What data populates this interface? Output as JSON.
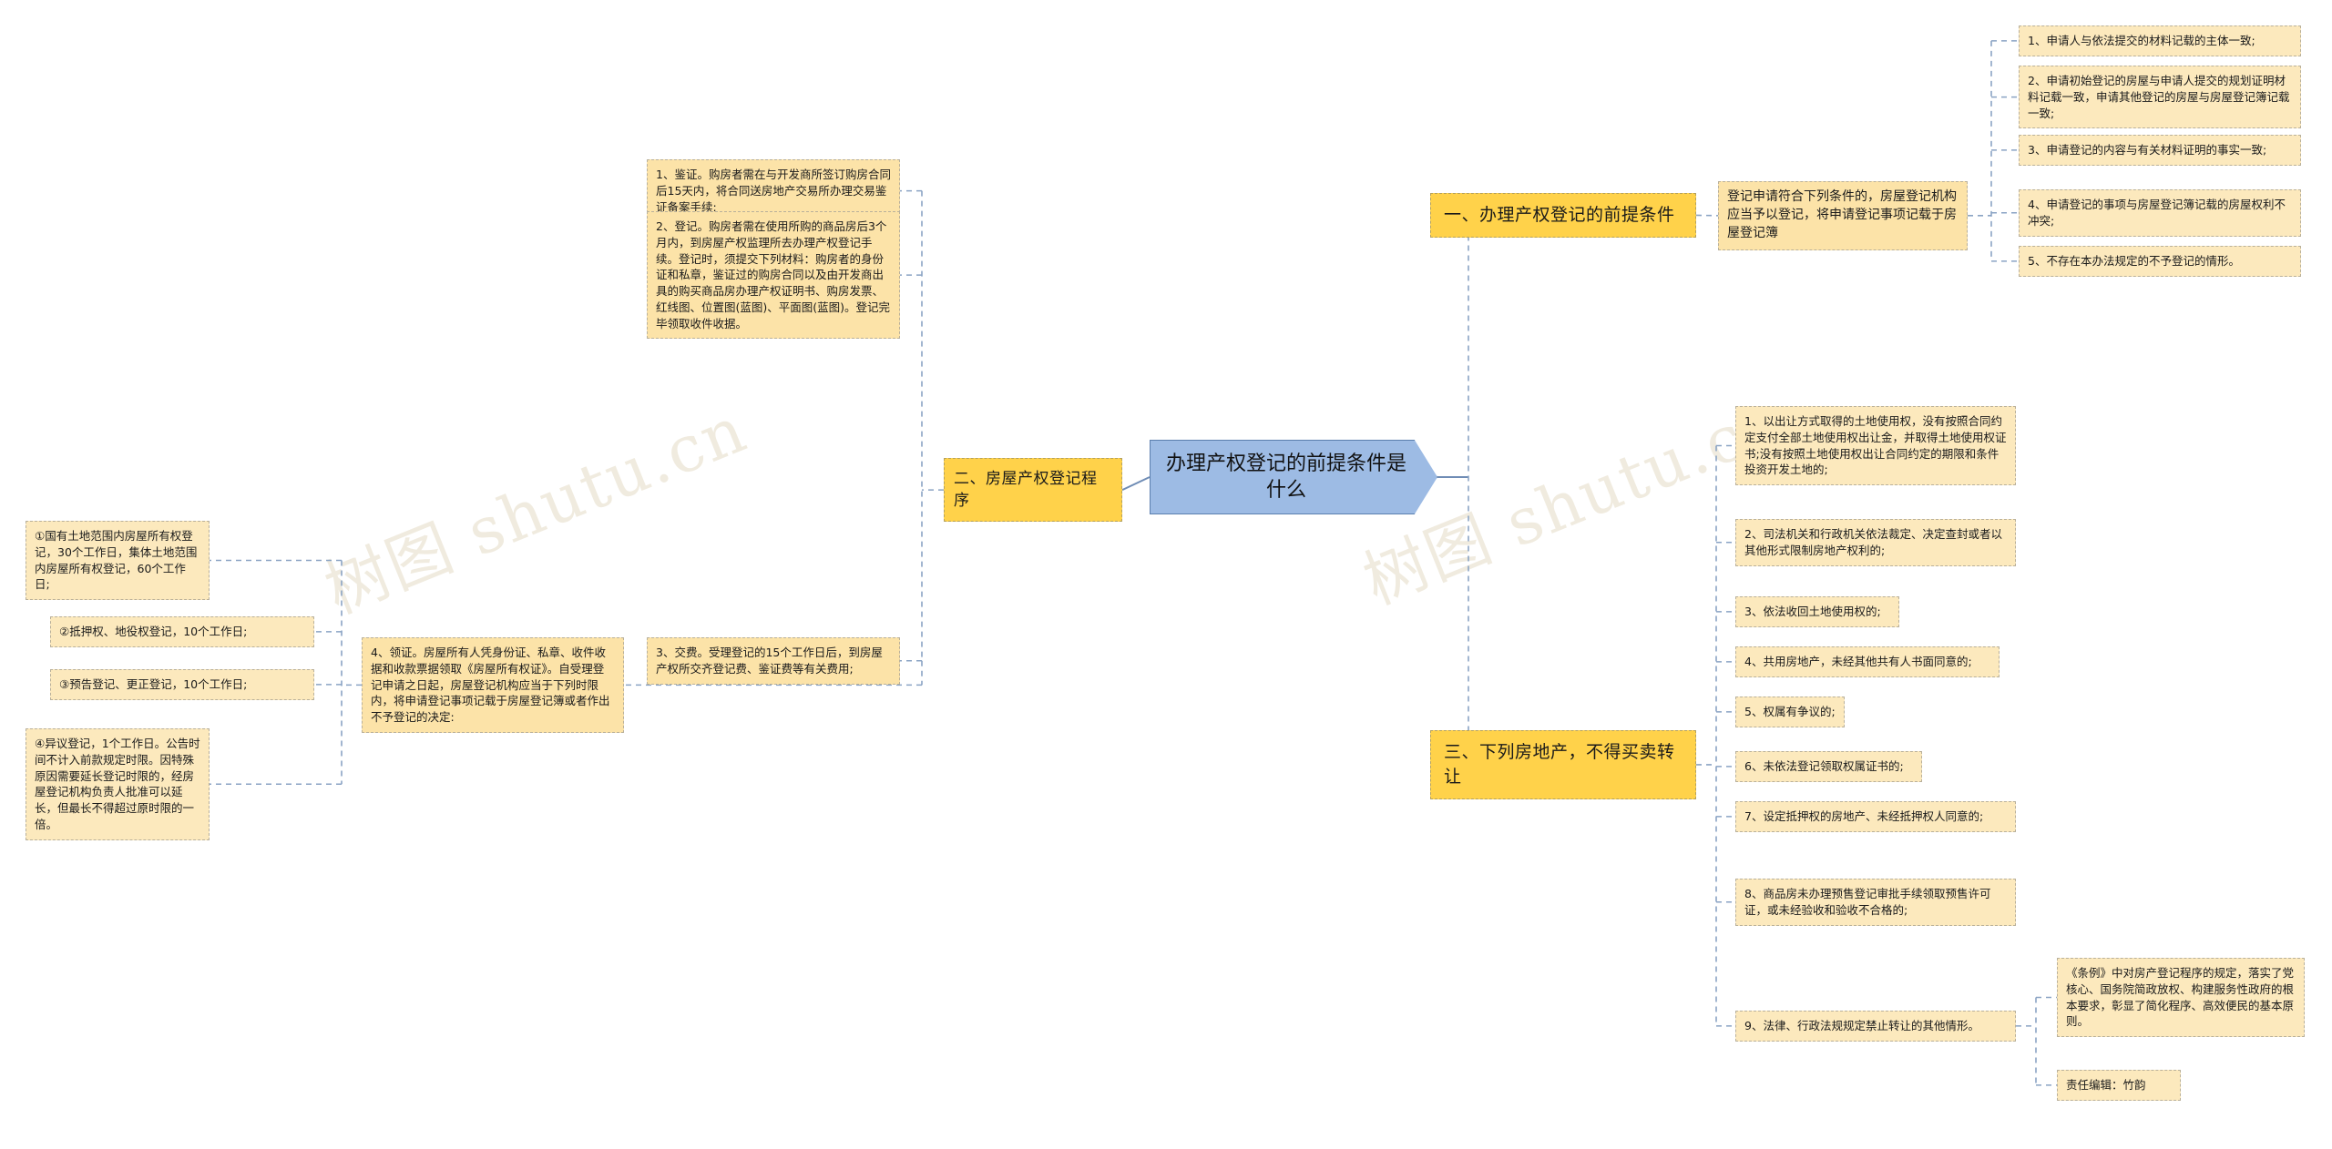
{
  "meta": {
    "watermark_left": "树图 shutu.cn",
    "watermark_right": "树图 shutu.cn",
    "colors": {
      "root_fill": "#9dbbe4",
      "root_stroke": "#5b7fae",
      "level1_fill": "#ffd24a",
      "level2_fill": "#fce3a8",
      "level3_fill": "#fce9bd",
      "node_border": "#b9b09a",
      "connector": "#8aa3c4",
      "background": "#ffffff"
    }
  },
  "root": {
    "title": "办理产权登记的前提条件是什么"
  },
  "branches": {
    "b1": {
      "label": "一、办理产权登记的前提条件",
      "intro": "登记申请符合下列条件的，房屋登记机构应当予以登记，将申请登记事项记载于房屋登记簿",
      "items": [
        "1、申请人与依法提交的材料记载的主体一致;",
        "2、申请初始登记的房屋与申请人提交的规划证明材料记载一致，申请其他登记的房屋与房屋登记簿记载一致;",
        "3、申请登记的内容与有关材料证明的事实一致;",
        "4、申请登记的事项与房屋登记簿记载的房屋权利不冲突;",
        "5、不存在本办法规定的不予登记的情形。"
      ]
    },
    "b2": {
      "label": "二、房屋产权登记程序",
      "steps": [
        "1、鉴证。购房者需在与开发商所签订购房合同后15天内，将合同送房地产交易所办理交易鉴证备案手续;",
        "2、登记。购房者需在使用所购的商品房后3个月内，到房屋产权监理所去办理产权登记手续。登记时，须提交下列材料：购房者的身份证和私章，鉴证过的购房合同以及由开发商出具的购买商品房办理产权证明书、购房发票、红线图、位置图(蓝图)、平面图(蓝图)。登记完毕领取收件收据。",
        "3、交费。受理登记的15个工作日后，到房屋产权所交齐登记费、鉴证费等有关费用;",
        "4、领证。房屋所有人凭身份证、私章、收件收据和收款票据领取《房屋所有权证》。自受理登记申请之日起，房屋登记机构应当于下列时限内，将申请登记事项记载于房屋登记簿或者作出不予登记的决定:"
      ],
      "time_limits": [
        "①国有土地范围内房屋所有权登记，30个工作日，集体土地范围内房屋所有权登记，60个工作日;",
        "②抵押权、地役权登记，10个工作日;",
        "③预告登记、更正登记，10个工作日;",
        "④异议登记，1个工作日。公告时间不计入前款规定时限。因特殊原因需要延长登记时限的，经房屋登记机构负责人批准可以延长，但最长不得超过原时限的一倍。"
      ]
    },
    "b3": {
      "label": "三、下列房地产，不得买卖转让",
      "items": [
        "1、以出让方式取得的土地使用权，没有按照合同约定支付全部土地使用权出让金，并取得土地使用权证书;没有按照土地使用权出让合同约定的期限和条件投资开发土地的;",
        "2、司法机关和行政机关依法裁定、决定查封或者以其他形式限制房地产权利的;",
        "3、依法收回土地使用权的;",
        "4、共用房地产，未经其他共有人书面同意的;",
        "5、权属有争议的;",
        "6、未依法登记领取权属证书的;",
        "7、设定抵押权的房地产、未经抵押权人同意的;",
        "8、商品房未办理预售登记审批手续领取预售许可证，或未经验收和验收不合格的;",
        "9、法律、行政法规规定禁止转让的其他情形。"
      ],
      "summary": "《条例》中对房产登记程序的规定，落实了党核心、国务院简政放权、构建服务性政府的根本要求，彰显了简化程序、高效便民的基本原则。",
      "editor": "责任编辑：竹韵"
    }
  }
}
